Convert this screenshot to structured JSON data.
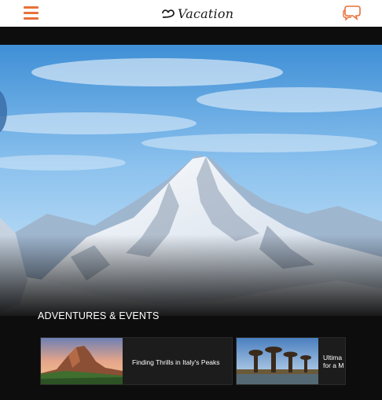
{
  "header": {
    "logo_text": "Vacation",
    "menu_icon": "hamburger-menu-icon",
    "chat_icon": "chat-bubbles-icon",
    "accent_color": "#e8713a"
  },
  "hero": {
    "image": "snowy-mountain-peak"
  },
  "section": {
    "title": "ADVENTURES & EVENTS"
  },
  "cards": [
    {
      "title": "Finding Thrills in Italy's Peaks",
      "image": "dolomites-sunset"
    },
    {
      "title": "Ultima\nfor a M",
      "image": "baobab-avenue"
    }
  ]
}
